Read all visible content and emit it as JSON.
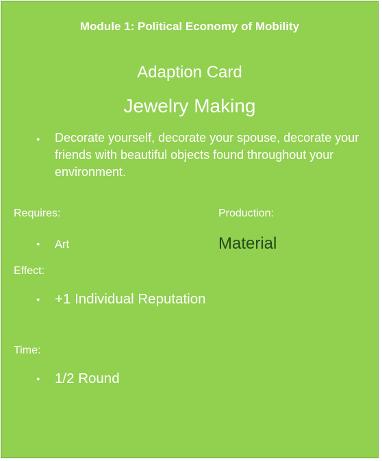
{
  "card": {
    "header": "Module 1: Political Economy of Mobility",
    "type": "Adaption Card",
    "name": "Jewelry Making",
    "description": "Decorate yourself, decorate your spouse, decorate your friends with beautiful objects found throughout your environment.",
    "requires_label": "Requires:",
    "requires_value": "Art",
    "production_label": "Production:",
    "production_value": "Material",
    "effect_label": "Effect:",
    "effect_value": "+1 Individual Reputation",
    "time_label": "Time:",
    "time_value": "1/2 Round",
    "bullet": "●"
  },
  "colors": {
    "card_background": "#92d050",
    "text": "#ffffff",
    "production_text": "#244a1c"
  }
}
